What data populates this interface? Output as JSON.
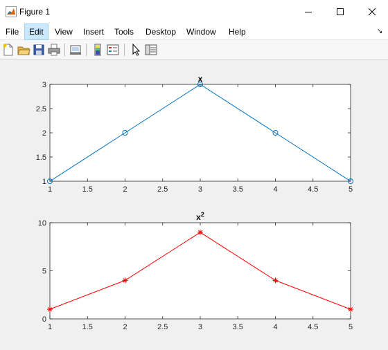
{
  "window": {
    "title": "Figure 1"
  },
  "menu": {
    "items": [
      "File",
      "Edit",
      "View",
      "Insert",
      "Tools",
      "Desktop",
      "Window",
      "Help"
    ],
    "active": "Edit"
  },
  "toolbar": {
    "icons": [
      "new-figure-icon",
      "open-file-icon",
      "save-figure-icon",
      "print-figure-icon",
      "link-plot-icon",
      "insert-colorbar-icon",
      "insert-legend-icon",
      "edit-plot-icon",
      "property-inspector-icon"
    ]
  },
  "chart_data": [
    {
      "type": "line",
      "title": "x",
      "x": [
        1,
        2,
        3,
        4,
        5
      ],
      "series": [
        {
          "values": [
            1,
            2,
            3,
            2,
            1
          ],
          "color": "#0072bd",
          "marker": "circle"
        }
      ],
      "xlim": [
        1,
        5
      ],
      "ylim": [
        1,
        3
      ],
      "xticks": [
        "1",
        "1.5",
        "2",
        "2.5",
        "3",
        "3.5",
        "4",
        "4.5",
        "5"
      ],
      "yticks": [
        "1",
        "1.5",
        "2",
        "2.5",
        "3"
      ]
    },
    {
      "type": "line",
      "title": "x",
      "title_superscript": "2",
      "x": [
        1,
        2,
        3,
        4,
        5
      ],
      "series": [
        {
          "values": [
            1,
            4,
            9,
            4,
            1
          ],
          "color": "#ff0000",
          "marker": "asterisk"
        }
      ],
      "xlim": [
        1,
        5
      ],
      "ylim": [
        0,
        10
      ],
      "xticks": [
        "1",
        "1.5",
        "2",
        "2.5",
        "3",
        "3.5",
        "4",
        "4.5",
        "5"
      ],
      "yticks": [
        "0",
        "5",
        "10"
      ]
    }
  ]
}
